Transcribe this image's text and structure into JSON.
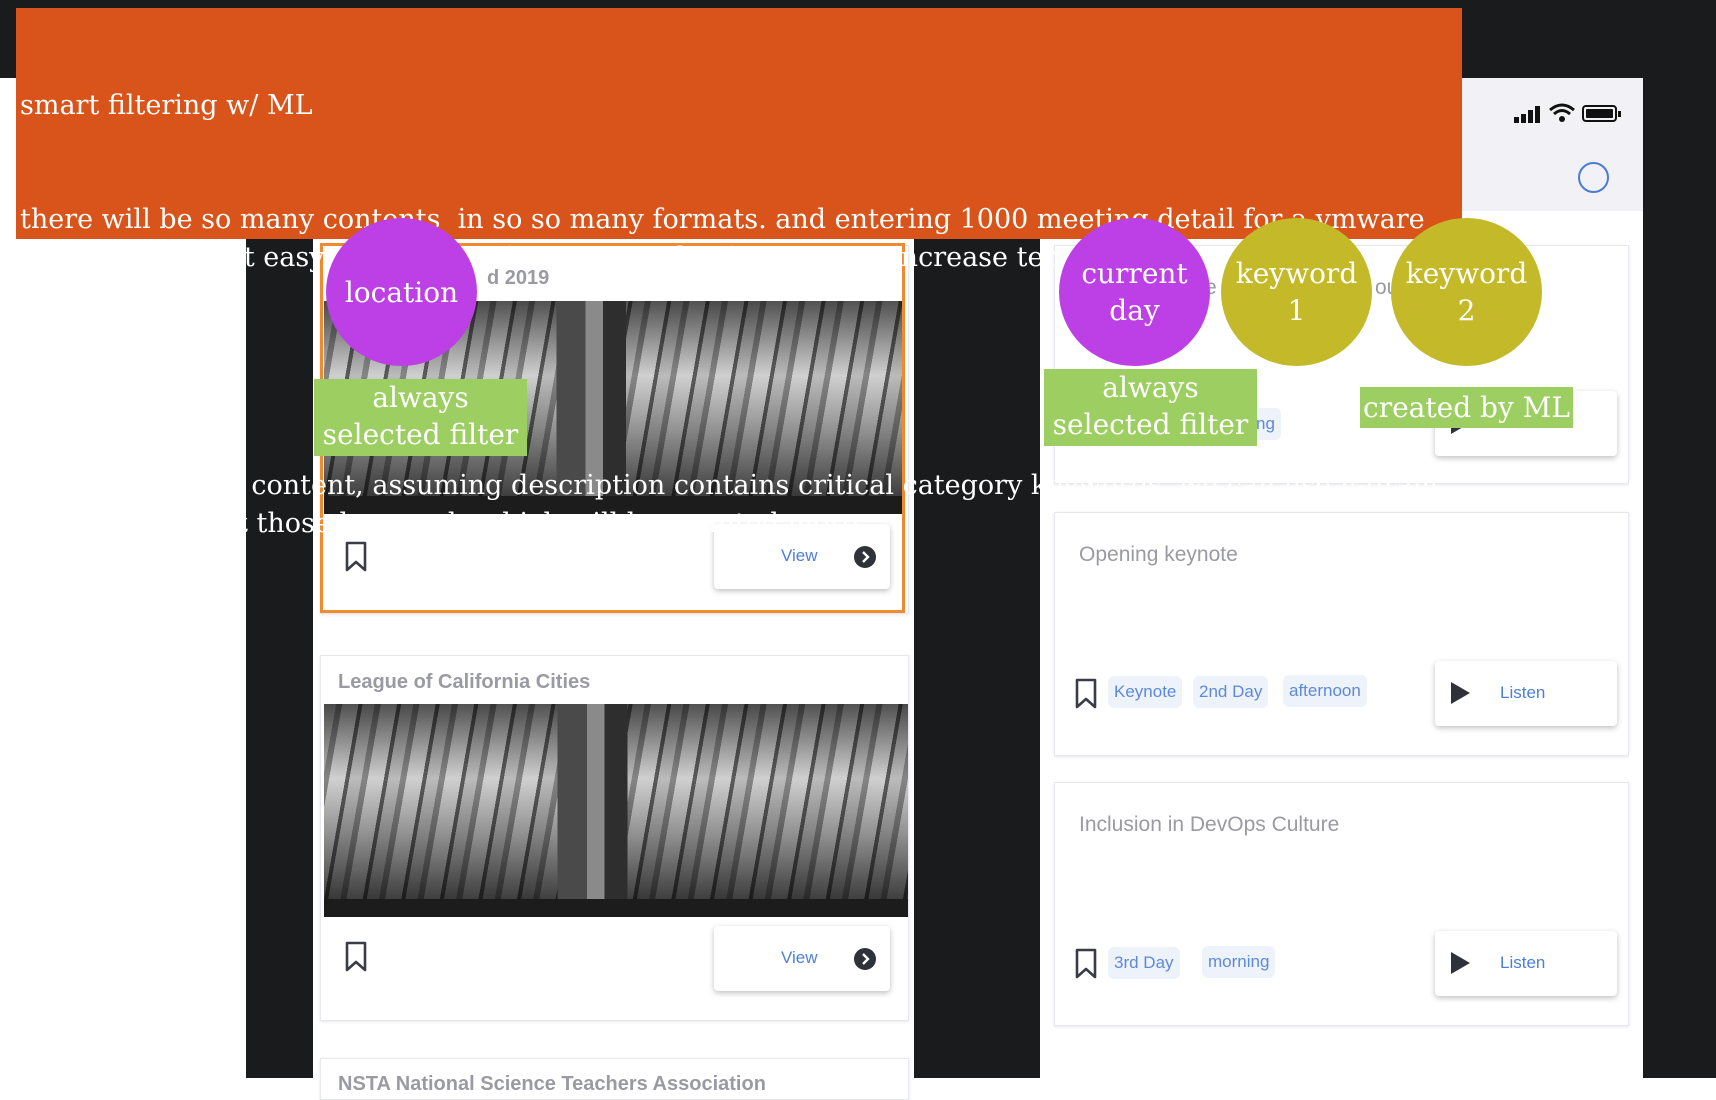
{
  "annotation": {
    "lines": [
      "smart filtering w/ ML",
      "there will be so many contents  in so so many formats. and entering 1000 meeting detail for a vmware convention is not easy. + classification or tag selection process increase tension.",
      "",
      "with description content, assuming description contains critical category keywords, we can use n-gram models to detect those keywords which will be counted more."
    ]
  },
  "left_phone": {
    "cards": [
      {
        "title": "d 2019",
        "button": "View"
      },
      {
        "title": "League of California Cities",
        "button": "View"
      },
      {
        "title": "NSTA National Science Teachers Association"
      }
    ]
  },
  "right_phone": {
    "cards": [
      {
        "title_fragments": [
          "e",
          "ou"
        ],
        "tag_fragment": "ng",
        "button": "Listen"
      },
      {
        "title": "Opening keynote",
        "tags": [
          "Keynote",
          "2nd Day",
          "afternoon"
        ],
        "button": "Listen"
      },
      {
        "title": "Inclusion in DevOps Culture",
        "tags": [
          "3rd Day",
          "morning"
        ],
        "button": "Listen"
      }
    ]
  },
  "bubbles": {
    "location": "location",
    "current_day": [
      "current",
      "day"
    ],
    "keyword1": [
      "keyword",
      "1"
    ],
    "keyword2": [
      "keyword",
      "2"
    ]
  },
  "labels": {
    "always_selected_left": [
      "always",
      "selected filter"
    ],
    "always_selected_right": [
      "always",
      "selected filter"
    ],
    "created_by_ml": "created by ML"
  },
  "colors": {
    "annotation_bg": "#d9541a",
    "purple": "#bd3fe6",
    "olive": "#c4b928",
    "green": "#9cce62",
    "highlight": "#ef8a2e",
    "link_blue": "#4d7fd8"
  }
}
